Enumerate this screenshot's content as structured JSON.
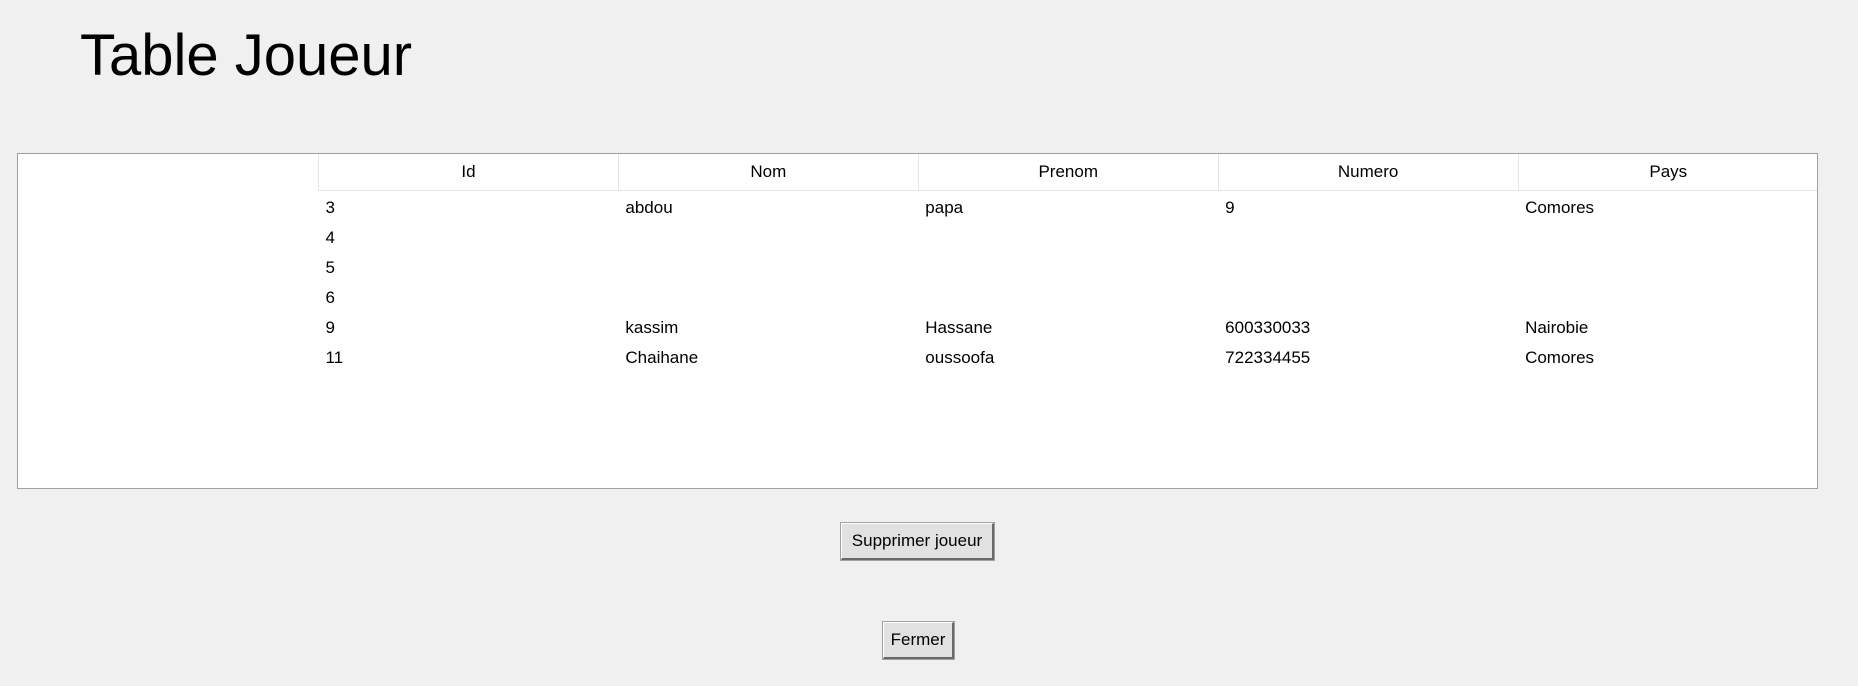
{
  "page": {
    "title": "Table Joueur"
  },
  "table": {
    "columns": [
      "Id",
      "Nom",
      "Prenom",
      "Numero",
      "Pays"
    ],
    "rows": [
      [
        "3",
        "abdou",
        "papa",
        "9",
        "Comores"
      ],
      [
        "4",
        "",
        "",
        "",
        ""
      ],
      [
        "5",
        "",
        "",
        "",
        ""
      ],
      [
        "6",
        "",
        "",
        "",
        ""
      ],
      [
        "9",
        "kassim",
        "Hassane",
        "600330033",
        "Nairobie"
      ],
      [
        "11",
        "Chaihane",
        "oussoofa",
        "722334455",
        "Comores"
      ]
    ]
  },
  "buttons": {
    "delete_label": "Supprimer joueur",
    "close_label": "Fermer"
  }
}
